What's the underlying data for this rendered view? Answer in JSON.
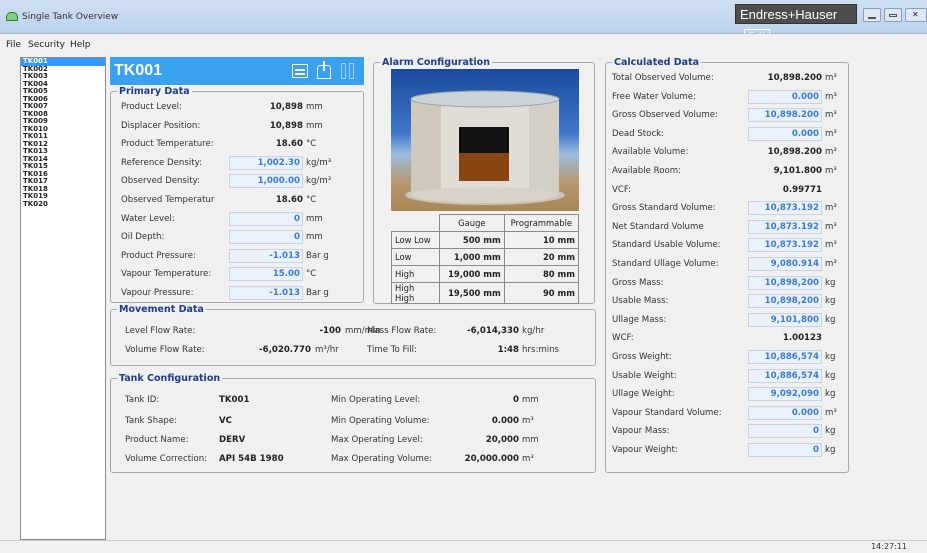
{
  "window": {
    "title": "Single Tank Overview",
    "brand": "Endress+Hauser",
    "brand_logo": "E+H"
  },
  "menu": [
    "File",
    "Security",
    "Help"
  ],
  "tanks": [
    "TK001",
    "TK002",
    "TK003",
    "TK004",
    "TK005",
    "TK006",
    "TK007",
    "TK008",
    "TK009",
    "TK010",
    "TK011",
    "TK012",
    "TK013",
    "TK014",
    "TK015",
    "TK016",
    "TK017",
    "TK018",
    "TK019",
    "TK020"
  ],
  "selected_tank": "TK001",
  "primary": {
    "title": "Primary Data",
    "rows": [
      {
        "label": "Product Level:",
        "value": "10,898",
        "unit": "mm",
        "boxed": false
      },
      {
        "label": "Displacer Position:",
        "value": "10,898",
        "unit": "mm",
        "boxed": false
      },
      {
        "label": "Product Temperature:",
        "value": "18.60",
        "unit": "°C",
        "boxed": false
      },
      {
        "label": "Reference Density:",
        "value": "1,002.30",
        "unit": "kg/m³",
        "boxed": true
      },
      {
        "label": "Observed Density:",
        "value": "1,000.00",
        "unit": "kg/m³",
        "boxed": true
      },
      {
        "label": "Observed Temperatur",
        "value": "18.60",
        "unit": "°C",
        "boxed": false
      },
      {
        "label": "Water Level:",
        "value": "0",
        "unit": "mm",
        "boxed": true
      },
      {
        "label": "Oil Depth:",
        "value": "0",
        "unit": "mm",
        "boxed": true
      },
      {
        "label": "Product Pressure:",
        "value": "-1.013",
        "unit": "Bar g",
        "boxed": true
      },
      {
        "label": "Vapour Temperature:",
        "value": "15.00",
        "unit": "°C",
        "boxed": true
      },
      {
        "label": "Vapour Pressure:",
        "value": "-1.013",
        "unit": "Bar g",
        "boxed": true
      }
    ]
  },
  "alarm": {
    "title": "Alarm Configuration",
    "headers": [
      "Gauge",
      "Programmable"
    ],
    "rows": [
      {
        "label": "Low Low",
        "gauge": "500 mm",
        "prog": "10 mm"
      },
      {
        "label": "Low",
        "gauge": "1,000 mm",
        "prog": "20 mm"
      },
      {
        "label": "High",
        "gauge": "19,000 mm",
        "prog": "80 mm"
      },
      {
        "label": "High High",
        "gauge": "19,500 mm",
        "prog": "90 mm"
      }
    ]
  },
  "movement": {
    "title": "Movement Data",
    "level_flow_label": "Level Flow Rate:",
    "level_flow_value": "-100",
    "level_flow_unit": "mm/min",
    "volume_flow_label": "Volume Flow Rate:",
    "volume_flow_value": "-6,020.770",
    "volume_flow_unit": "m³/hr",
    "mass_flow_label": "Mass Flow Rate:",
    "mass_flow_value": "-6,014,330",
    "mass_flow_unit": "kg/hr",
    "time_fill_label": "Time To Fill:",
    "time_fill_value": "1:48",
    "time_fill_unit": "hrs:mins"
  },
  "config": {
    "title": "Tank Configuration",
    "tank_id_label": "Tank ID:",
    "tank_id": "TK001",
    "shape_label": "Tank Shape:",
    "shape": "VC",
    "product_label": "Product Name:",
    "product": "DERV",
    "correction_label": "Volume Correction:",
    "correction": "API 54B 1980",
    "min_level_label": "Min Operating Level:",
    "min_level": "0",
    "min_level_unit": "mm",
    "min_vol_label": "Min Operating Volume:",
    "min_vol": "0.000",
    "min_vol_unit": "m³",
    "max_level_label": "Max Operating Level:",
    "max_level": "20,000",
    "max_level_unit": "mm",
    "max_vol_label": "Max Operating Volume:",
    "max_vol": "20,000.000",
    "max_vol_unit": "m³"
  },
  "calculated": {
    "title": "Calculated Data",
    "rows": [
      {
        "label": "Total Observed Volume:",
        "value": "10,898.200",
        "unit": "m³",
        "boxed": false
      },
      {
        "label": "Free Water Volume:",
        "value": "0.000",
        "unit": "m³",
        "boxed": true
      },
      {
        "label": "Gross Observed Volume:",
        "value": "10,898.200",
        "unit": "m³",
        "boxed": true
      },
      {
        "label": "Dead Stock:",
        "value": "0.000",
        "unit": "m³",
        "boxed": true
      },
      {
        "label": "Available Volume:",
        "value": "10,898.200",
        "unit": "m³",
        "boxed": false
      },
      {
        "label": "Available Room:",
        "value": "9,101.800",
        "unit": "m³",
        "boxed": false
      },
      {
        "label": "VCF:",
        "value": "0.99771",
        "unit": "",
        "boxed": false
      },
      {
        "label": "Gross Standard Volume:",
        "value": "10,873.192",
        "unit": "m³",
        "boxed": true
      },
      {
        "label": "Net Standard Volume",
        "value": "10,873.192",
        "unit": "m³",
        "boxed": true
      },
      {
        "label": "Standard Usable Volume:",
        "value": "10,873.192",
        "unit": "m³",
        "boxed": true
      },
      {
        "label": "Standard Ullage Volume:",
        "value": "9,080.914",
        "unit": "m³",
        "boxed": true
      },
      {
        "label": "Gross Mass:",
        "value": "10,898,200",
        "unit": "kg",
        "boxed": true
      },
      {
        "label": "Usable Mass:",
        "value": "10,898,200",
        "unit": "kg",
        "boxed": true
      },
      {
        "label": "Ullage Mass:",
        "value": "9,101,800",
        "unit": "kg",
        "boxed": true
      },
      {
        "label": "WCF:",
        "value": "1.00123",
        "unit": "",
        "boxed": false
      },
      {
        "label": "Gross Weight:",
        "value": "10,886,574",
        "unit": "kg",
        "boxed": true
      },
      {
        "label": "Usable Weight:",
        "value": "10,886,574",
        "unit": "kg",
        "boxed": true
      },
      {
        "label": "Ullage Weight:",
        "value": "9,092,090",
        "unit": "kg",
        "boxed": true
      },
      {
        "label": "Vapour Standard Volume:",
        "value": "0.000",
        "unit": "m³",
        "boxed": true
      },
      {
        "label": "Vapour Mass:",
        "value": "0",
        "unit": "kg",
        "boxed": true
      },
      {
        "label": "Vapour Weight:",
        "value": "0",
        "unit": "kg",
        "boxed": true
      }
    ]
  },
  "status": {
    "time": "14:27:11"
  },
  "colors": {
    "accent": "#3aa0f0",
    "group_title": "#1e3c8c",
    "value_blue": "#3a7bd5",
    "product_fill": "#8b4513"
  }
}
